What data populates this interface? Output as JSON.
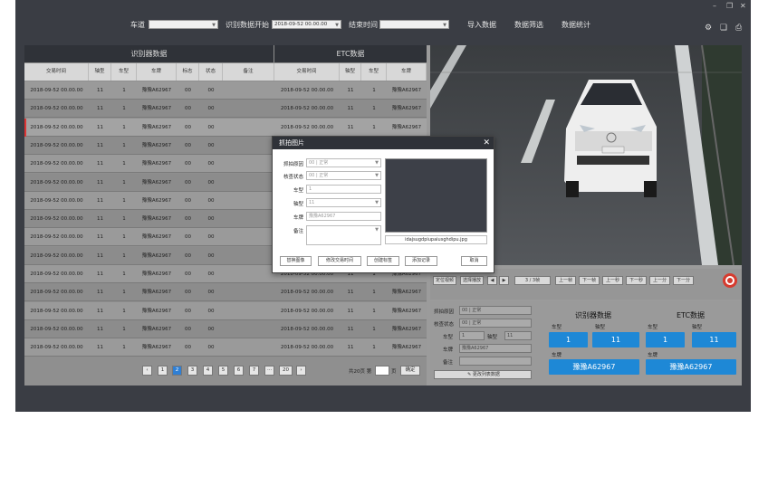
{
  "topbar": {
    "lane_label": "车道",
    "lane_value": "",
    "start_label": "识别数据开始",
    "start_value": "2018-09-52 00.00.00",
    "end_label": "结束时间",
    "end_value": "",
    "menu": [
      "导入数据",
      "数据筛选",
      "数据统计"
    ]
  },
  "window": {
    "minimize": "–",
    "restore": "❐",
    "close": "✕"
  },
  "tools": [
    "⚙",
    "❏",
    "⎙"
  ],
  "left_table": {
    "group_left": "识别器数据",
    "group_right": "ETC数据",
    "headers_left": [
      "交易时间",
      "轴型",
      "车型",
      "车牌",
      "标志",
      "状态",
      "备注"
    ],
    "headers_right": [
      "交易时间",
      "轴型",
      "车型",
      "车牌"
    ],
    "rows": [
      [
        "2018-09-52 00.00.00",
        "11",
        "1",
        "豫豫A62967",
        "00",
        "00",
        "",
        "2018-09-52 00.00.00",
        "11",
        "1",
        "豫豫A62967"
      ],
      [
        "2018-09-52 00.00.00",
        "11",
        "1",
        "豫豫A62967",
        "00",
        "00",
        "",
        "2018-09-52 00.00.00",
        "11",
        "1",
        "豫豫A62967"
      ],
      [
        "2018-09-52 00.00.00",
        "11",
        "1",
        "豫豫A62967",
        "00",
        "00",
        "",
        "2018-09-52 00.00.00",
        "11",
        "1",
        "豫豫A62967"
      ],
      [
        "2018-09-52 00.00.00",
        "11",
        "1",
        "豫豫A62967",
        "00",
        "00",
        "",
        "2018-09-52 00.00.00",
        "11",
        "1",
        "豫豫A62967"
      ],
      [
        "2018-09-52 00.00.00",
        "11",
        "1",
        "豫豫A62967",
        "00",
        "00",
        "",
        "2018-09-52 00.00.00",
        "11",
        "1",
        "豫豫A62967"
      ],
      [
        "2018-09-52 00.00.00",
        "11",
        "1",
        "豫豫A62967",
        "00",
        "00",
        "",
        "2018-09-52 00.00.00",
        "11",
        "1",
        "豫豫A62967"
      ],
      [
        "2018-09-52 00.00.00",
        "11",
        "1",
        "豫豫A62967",
        "00",
        "00",
        "",
        "2018-09-52 00.00.00",
        "11",
        "1",
        "豫豫A62967"
      ],
      [
        "2018-09-52 00.00.00",
        "11",
        "1",
        "豫豫A62967",
        "00",
        "00",
        "",
        "2018-09-52 00.00.00",
        "11",
        "1",
        "豫豫A62967"
      ],
      [
        "2018-09-52 00.00.00",
        "11",
        "1",
        "豫豫A62967",
        "00",
        "00",
        "",
        "2018-09-52 00.00.00",
        "11",
        "1",
        "豫豫A62967"
      ],
      [
        "2018-09-52 00.00.00",
        "11",
        "1",
        "豫豫A62967",
        "00",
        "00",
        "",
        "2018-09-52 00.00.00",
        "11",
        "1",
        "豫豫A62967"
      ],
      [
        "2018-09-52 00.00.00",
        "11",
        "1",
        "豫豫A62967",
        "00",
        "00",
        "",
        "2018-09-52 00.00.00",
        "11",
        "1",
        "豫豫A62967"
      ],
      [
        "2018-09-52 00.00.00",
        "11",
        "1",
        "豫豫A62967",
        "00",
        "00",
        "",
        "2018-09-52 00.00.00",
        "11",
        "1",
        "豫豫A62967"
      ],
      [
        "2018-09-52 00.00.00",
        "11",
        "1",
        "豫豫A62967",
        "00",
        "00",
        "",
        "2018-09-52 00.00.00",
        "11",
        "1",
        "豫豫A62967"
      ],
      [
        "2018-09-52 00.00.00",
        "11",
        "1",
        "豫豫A62967",
        "00",
        "00",
        "",
        "2018-09-52 00.00.00",
        "11",
        "1",
        "豫豫A62967"
      ],
      [
        "2018-09-52 00.00.00",
        "11",
        "1",
        "豫豫A62967",
        "00",
        "00",
        "",
        "2018-09-52 00.00.00",
        "11",
        "1",
        "豫豫A62967"
      ]
    ]
  },
  "pager": {
    "prev": "‹",
    "pages": [
      "1",
      "2",
      "3",
      "4",
      "5",
      "6",
      "7",
      "···",
      "20"
    ],
    "current": "2",
    "next": "›",
    "total_prefix": "共20页 第",
    "page_input": "",
    "total_suffix": "页",
    "confirm": "确定"
  },
  "ctrlbar": {
    "buttons": [
      "定位视频",
      "选择播放",
      "◀",
      "▶",
      "3 / 3帧",
      "上一帧",
      "下一帧",
      "上一秒",
      "下一秒",
      "上一分",
      "下一分"
    ]
  },
  "lower": {
    "reason_label": "抓拍原因",
    "reason_value": "00 | 正常",
    "check_label": "核查状态",
    "check_value": "00 | 正常",
    "type_label": "车型",
    "type_value": "1",
    "axle_label": "轴型",
    "axle_value": "11",
    "plate_label": "车牌",
    "plate_value": "豫豫A62967",
    "remark_label": "备注",
    "remark_value": "",
    "update_button": "更改列表数据",
    "recog_title": "识别器数据",
    "etc_title": "ETC数据",
    "recog_type_label": "车型",
    "recog_type": "1",
    "recog_axle_label": "轴型",
    "recog_axle": "11",
    "etc_type_label": "车型",
    "etc_type": "1",
    "etc_axle_label": "轴型",
    "etc_axle": "11",
    "recog_plate_label": "车牌",
    "recog_plate": "豫豫A62967",
    "etc_plate_label": "车牌",
    "etc_plate": "豫豫A62967"
  },
  "modal": {
    "title": "抓拍图片",
    "close": "✕",
    "reason_label": "抓拍原因",
    "reason_value": "00 | 正常",
    "check_label": "核查状态",
    "check_value": "00 | 正常",
    "type_label": "车型",
    "type_value": "1",
    "axle_label": "轴型",
    "axle_value": "11",
    "plate_label": "车牌",
    "plate_value": "豫豫A62967",
    "remark_label": "备注",
    "remark_value": "",
    "filename": "idajsugdpiupaiusghdipu.jpg",
    "buttons": [
      "替换图像",
      "修改交易时间",
      "创建标签",
      "添加记录",
      "取消"
    ]
  },
  "colors": {
    "accent_blue": "#1e88d6",
    "dark_bg": "#3a3d44",
    "header_bg": "#2f3238",
    "selected_marker": "#dd3333"
  },
  "icons": [
    "settings-icon",
    "copy-icon",
    "print-icon",
    "camera-lens-icon",
    "pencil-icon",
    "chevron-down-icon",
    "close-icon"
  ]
}
